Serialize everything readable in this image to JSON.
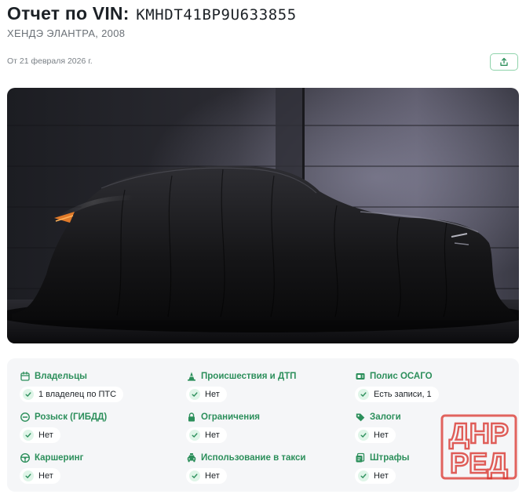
{
  "header": {
    "title_prefix": "Отчет по VIN:",
    "vin": "KMHDT41BP9U633855",
    "vehicle": "ХЕНДЭ ЭЛАНТРА, 2008",
    "date": "От 21 февраля 2026 г."
  },
  "summary": {
    "items": [
      {
        "title": "Владельцы",
        "value": "1 владелец по ПТС",
        "icon": "calendar-icon"
      },
      {
        "title": "Происшествия и ДТП",
        "value": "Нет",
        "icon": "warning-cone-icon"
      },
      {
        "title": "Полис ОСАГО",
        "value": "Есть записи, 1",
        "icon": "policy-card-icon"
      },
      {
        "title": "Розыск (ГИБДД)",
        "value": "Нет",
        "icon": "search-icon"
      },
      {
        "title": "Ограничения",
        "value": "Нет",
        "icon": "lock-icon"
      },
      {
        "title": "Залоги",
        "value": "Нет",
        "icon": "tag-icon"
      },
      {
        "title": "Каршеринг",
        "value": "Нет",
        "icon": "steering-wheel-icon"
      },
      {
        "title": "Использование в такси",
        "value": "Нет",
        "icon": "taxi-icon"
      },
      {
        "title": "Штрафы",
        "value": "Нет",
        "icon": "receipt-icon"
      }
    ]
  },
  "watermark": {
    "line1": "ДНР",
    "line2": "РЕД"
  },
  "colors": {
    "accent": "#2c8f5b",
    "check_bg": "#dff5e8",
    "panel_bg": "#f5f6f8",
    "watermark": "#d9322b"
  }
}
